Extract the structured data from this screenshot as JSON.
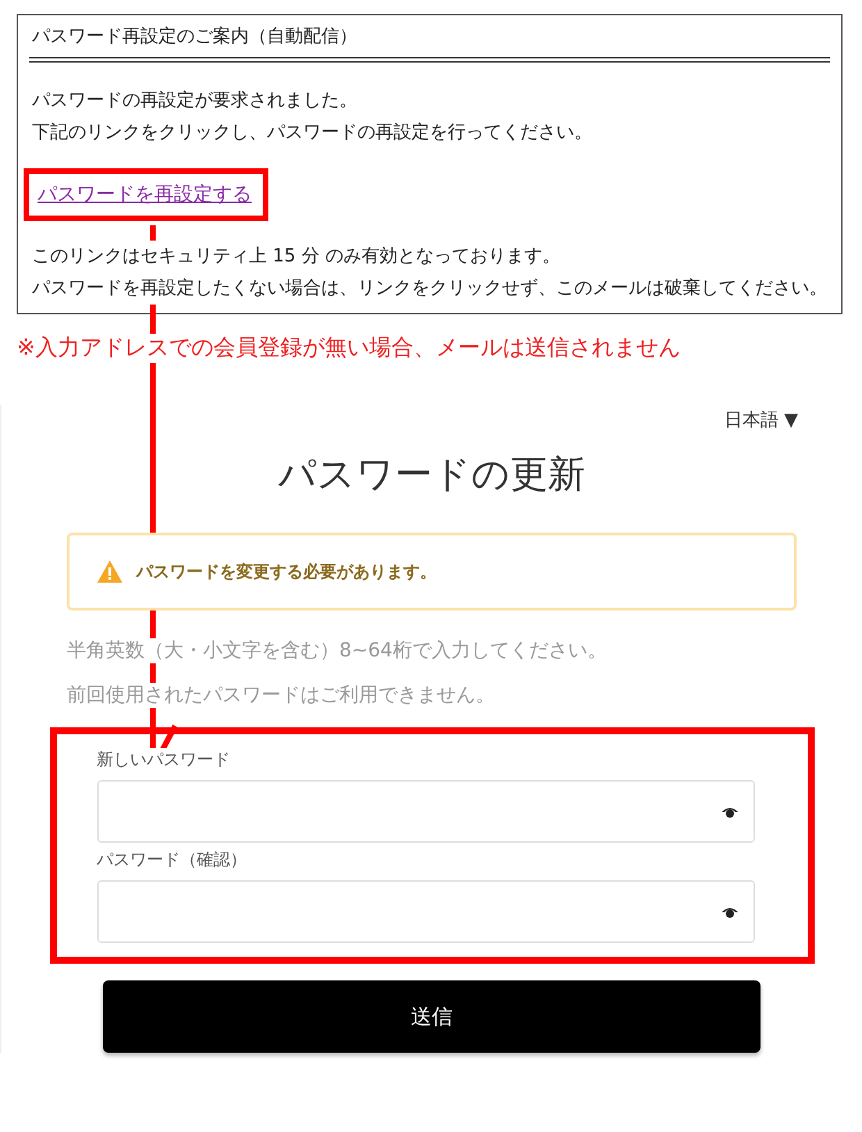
{
  "email": {
    "subject": "パスワード再設定のご案内（自動配信）",
    "intro": [
      "パスワードの再設定が要求されました。",
      "下記のリンクをクリックし、パスワードの再設定を行ってください。"
    ],
    "link": "パスワードを再設定する",
    "notes": [
      "このリンクはセキュリティ上 15 分 のみ有効となっております。",
      "パスワードを再設定したくない場合は、リンクをクリックせず、このメールは破棄してください。"
    ]
  },
  "note": "※入力アドレスでの会員登録が無い場合、メールは送信されません",
  "screen": {
    "language": "日本語 ▼",
    "title": "パスワードの更新",
    "alert": "パスワードを変更する必要があります。",
    "hints": [
      "半角英数（大・小文字を含む）8~64桁で入力してください。",
      "前回使用されたパスワードはご利用できません。"
    ],
    "fields": [
      {
        "label": "新しいパスワード"
      },
      {
        "label": "パスワード（確認）"
      }
    ],
    "submit": "送信"
  }
}
